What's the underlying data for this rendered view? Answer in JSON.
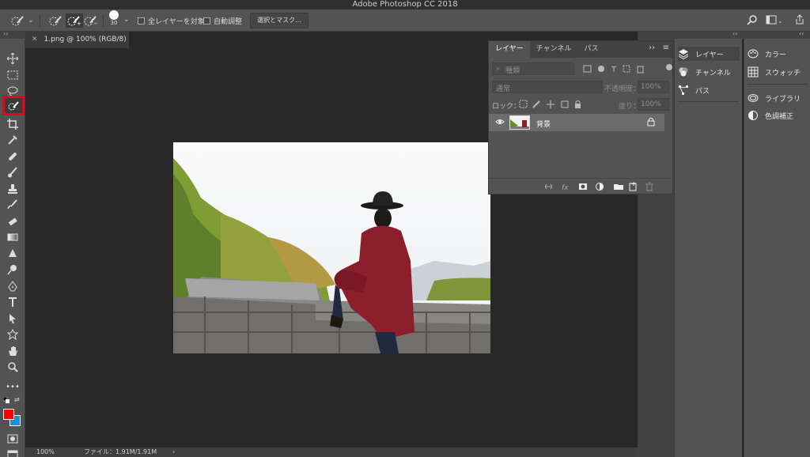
{
  "window": {
    "title": "Adobe Photoshop CC 2018"
  },
  "options_bar": {
    "brush_size": "30",
    "sample_all_layers": "全レイヤーを対象",
    "auto_enhance": "自動調整",
    "select_and_mask": "選択とマスク..."
  },
  "document": {
    "tab_title": "1.png @ 100% (RGB/8)",
    "zoom": "100%",
    "file_info": "ファイル：1.91M/1.91M"
  },
  "layers_panel": {
    "tabs": [
      "レイヤー",
      "チャンネル",
      "パス"
    ],
    "kind_label": "種類",
    "blend_mode": "通常",
    "opacity_label": "不透明度：",
    "opacity_value": "100%",
    "lock_label": "ロック：",
    "fill_label": "塗り：",
    "fill_value": "100%",
    "layer_name": "背景"
  },
  "dock_panels": {
    "column1": [
      "レイヤー",
      "チャンネル",
      "パス"
    ],
    "column2": [
      "カラー",
      "スウォッチ",
      "ライブラリ",
      "色調補正"
    ]
  },
  "colors": {
    "foreground": "#ff0000",
    "background": "#1e90d6",
    "active_tool_highlight": "#e8001f"
  },
  "icons": {
    "active_tool": "quick-selection-icon"
  }
}
